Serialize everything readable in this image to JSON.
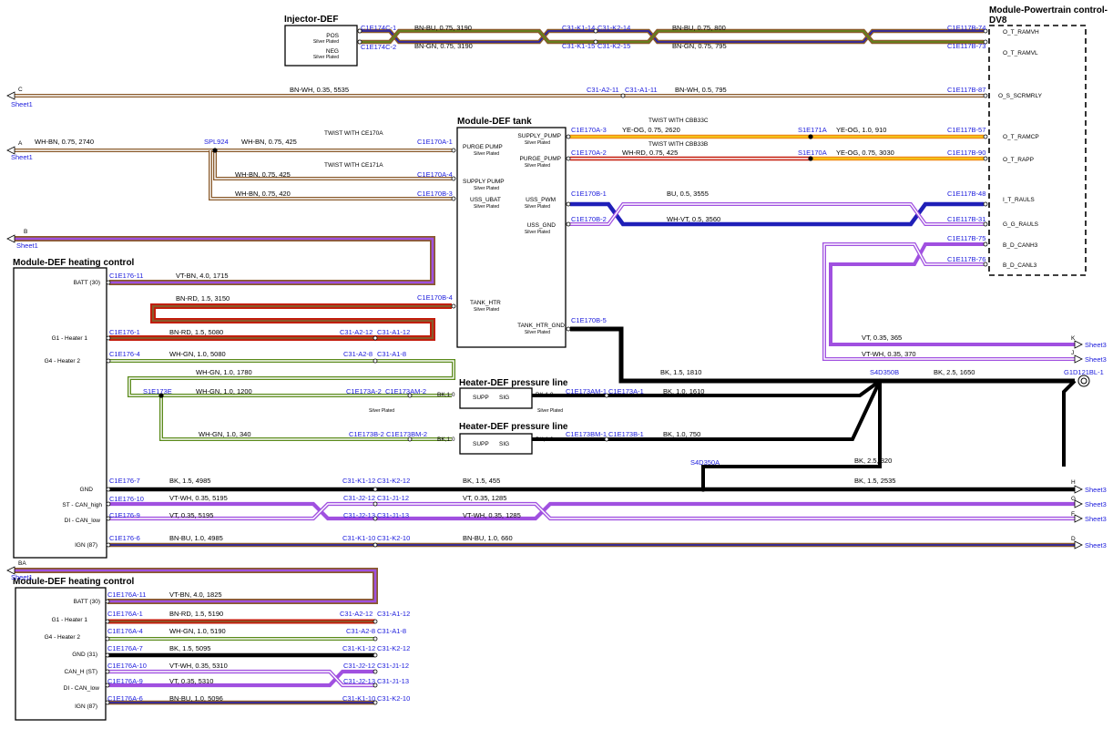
{
  "colors": {
    "BN": "#8a5a2b",
    "BU": "#1f1fb8",
    "GN": "#5a8a1a",
    "WH": "#ffffff",
    "YE": "#f2d318",
    "OG": "#f08a16",
    "RD": "#c41a0a",
    "VT": "#a050e0",
    "BK": "#000000",
    "connector_text": "#1a1adc"
  },
  "modules": {
    "injector": {
      "title": "Injector-DEF",
      "pins": [
        {
          "name": "POS",
          "note": "Silver Plated",
          "connector": "C1E174C-1"
        },
        {
          "name": "NEG",
          "note": "Silver Plated",
          "connector": "C1E174C-2"
        }
      ]
    },
    "pcm": {
      "title_line1": "Module-Powertrain control-",
      "title_line2": "DV8",
      "pins": [
        "O_T_RAMVH",
        "O_T_RAMVL",
        "O_S_SCRMRLY",
        "O_T_RAMCP",
        "O_T_RAPP",
        "I_T_RAULS",
        "G_G_RAULS",
        "B_D_CANH3",
        "B_D_CANL3"
      ]
    },
    "tank": {
      "title": "Module-DEF tank",
      "left_pins": [
        {
          "name": "PURGE PUMP",
          "note": "Silver Plated"
        },
        {
          "name": "SUPPLY PUMP",
          "note": "Silver Plated"
        },
        {
          "name": "USS_UBAT",
          "note": "Silver Plated"
        },
        {
          "name": "TANK_HTR",
          "note": "Silver Plated"
        }
      ],
      "right_pins": [
        {
          "name": "SUPPLY_PUMP",
          "note": "Silver Plated"
        },
        {
          "name": "PURGE_PUMP",
          "note": "Silver Plated"
        },
        {
          "name": "USS_PWM",
          "note": "Silver Plated"
        },
        {
          "name": "USS_GND",
          "note": "Silver Plated"
        },
        {
          "name": "TANK_HTR_GND",
          "note": "Silver Plated"
        }
      ]
    },
    "heating1": {
      "title": "Module-DEF heating control",
      "pins": [
        "BATT (30)",
        "G1 - Heater 1",
        "G4 - Heater 2",
        "GND",
        "ST - CAN_high",
        "DI - CAN_low",
        "IGN (87)"
      ]
    },
    "heating2": {
      "title": "Module-DEF heating control",
      "pins": [
        "BATT (30)",
        "G1 - Heater 1",
        "G4 - Heater 2",
        "GND (31)",
        "CAN_H (ST)",
        "DI - CAN_low",
        "IGN (87)"
      ]
    },
    "pressure_line_1": {
      "title": "Heater-DEF pressure line",
      "supp": "SUPP",
      "sig": "SIG",
      "note": "Silver Plated"
    },
    "pressure_line_2": {
      "title": "Heater-DEF pressure line",
      "supp": "SUPP",
      "sig": "SIG",
      "note": "Silver Plated"
    }
  },
  "connectors": {
    "inj_pos_c31": [
      "C31-K1-14",
      "C31-K2-14"
    ],
    "inj_neg_c31": [
      "C31-K1-15",
      "C31-K2-15"
    ],
    "c_line_c31": [
      "C31-A2-11",
      "C31-A1-11"
    ],
    "pcm_pos": "C1E117B-74",
    "pcm_neg": "C1E117B-73",
    "pcm_c": "C1E117B-87",
    "pcm_ramcp": "C1E117B-57",
    "pcm_rapp": "C1E117B-90",
    "pcm_uls": "C1E117B-48",
    "pcm_gnd": "C1E117B-31",
    "pcm_canh": "C1E117B-75",
    "pcm_canl": "C1E117B-76",
    "tank_a1": "C1E170A-1",
    "tank_a4": "C1E170A-4",
    "tank_b3": "C1E170B-3",
    "tank_a3": "C1E170A-3",
    "tank_a2": "C1E170A-2",
    "tank_b1": "C1E170B-1",
    "tank_b2": "C1E170B-2",
    "tank_b4": "C1E170B-4",
    "tank_b5": "C1E170B-5",
    "splice_spl924": "SPL924",
    "splice_s1e171a": "S1E171A",
    "splice_s1e170a": "S1E170A",
    "splice_s1e173e": "S1E173E",
    "splice_s4d350b": "S4D350B",
    "splice_s4d350a": "S4D350A",
    "ground": "G1D121BL-1",
    "h1": [
      "C1E176-11",
      "C1E176-1",
      "C1E176-4",
      "C1E176-7",
      "C1E176-10",
      "C1E176-9",
      "C1E176-6"
    ],
    "h2": [
      "C1E176A-11",
      "C1E176A-1",
      "C1E176A-4",
      "C1E176A-7",
      "C1E176A-10",
      "C1E176A-9",
      "C1E176A-6"
    ],
    "c31_heater1": [
      "C31-A2-12",
      "C31-A1-12"
    ],
    "c31_heater2": [
      "C31-A2-8",
      "C31-A1-8"
    ],
    "c31_gnd": [
      "C31-K1-12",
      "C31-K2-12"
    ],
    "c31_canh": [
      "C31-J2-12",
      "C31-J1-12"
    ],
    "c31_canl": [
      "C31-J2-13",
      "C31-J1-13"
    ],
    "c31_ign": [
      "C31-K1-10",
      "C31-K2-10"
    ],
    "c173a": [
      "C1E173A-2",
      "C1E173AM-2",
      "C1E173AM-1",
      "C1E173A-1"
    ],
    "c173b": [
      "C1E173B-2",
      "C1E173BM-2",
      "C1E173BM-1",
      "C1E173B-1"
    ]
  },
  "wires": {
    "inj_pos_a": "BN-BU, 0.75, 3190",
    "inj_pos_b": "BN-BU, 0.75, 800",
    "inj_neg_a": "BN-GN, 0.75, 3190",
    "inj_neg_b": "BN-GN, 0.75, 795",
    "c_a": "BN-WH, 0.35, 5535",
    "c_b": "BN-WH, 0.5, 795",
    "a_a": "WH-BN, 0.75, 2740",
    "a_b": "WH-BN, 0.75, 425",
    "a_c": "WH-BN, 0.75, 425",
    "a_d": "WH-BN, 0.75, 420",
    "twist_ce170a": "TWIST WITH CE170A",
    "twist_ce171a": "TWIST WITH CE171A",
    "twist_cbb33c": "TWIST WITH CBB33C",
    "twist_cbb33b": "TWIST WITH CBB33B",
    "supply_a": "YE-OG, 0.75, 2620",
    "supply_b": "YE-OG, 1.0, 910",
    "purge_a": "WH-RD, 0.75, 425",
    "purge_b": "YE-OG, 0.75, 3030",
    "uls": "BU, 0.5, 3555",
    "uls_gnd": "WH-VT, 0.5, 3560",
    "batt": "VT-BN, 4.0, 1715",
    "htr_tank": "BN-RD, 1.5, 3150",
    "htr1": "BN-RD, 1.5, 5080",
    "htr2_a": "WH-GN, 1.0, 5080",
    "htr2_b": "WH-GN, 1.0, 1780",
    "htr2_c": "WH-GN, 1.0, 1200",
    "htr2_d": "WH-GN, 1.0, 340",
    "bk10": "BK,1.0",
    "tank_gnd": "BK, 1.5, 1810",
    "gnd_main": "BK, 2.5, 1650",
    "pl1_gnd": "BK, 1.0, 1610",
    "pl2_gnd": "BK, 1.0, 750",
    "gnd_320": "BK, 2.5, 320",
    "gnd_a": "BK, 1.5, 4985",
    "gnd_b": "BK, 1.5, 455",
    "gnd_c": "BK, 1.5, 2535",
    "canh_a": "VT-WH, 0.35, 5195",
    "canh_b": "VT, 0.35, 1285",
    "canl_a": "VT, 0.35, 5195",
    "canl_b": "VT-WH, 0.35, 1285",
    "k": "VT, 0.35, 365",
    "j": "VT-WH, 0.35, 370",
    "ign_a": "BN-BU, 1.0, 4985",
    "ign_b": "BN-BU, 1.0, 660",
    "h2_batt": "VT-BN, 4.0, 1825",
    "h2_htr1": "BN-RD, 1.5, 5190",
    "h2_htr2": "WH-GN, 1.0, 5190",
    "h2_gnd": "BK, 1.5, 5095",
    "h2_canh": "VT-WH, 0.35, 5310",
    "h2_canl": "VT, 0.35, 5310",
    "h2_ign": "BN-BU, 1.0, 5096"
  },
  "sheet_refs": {
    "c": {
      "letter": "C",
      "sheet": "Sheet1"
    },
    "a": {
      "letter": "A",
      "sheet": "Sheet1"
    },
    "b": {
      "letter": "B",
      "sheet": "Sheet1"
    },
    "ba": {
      "letter": "BA",
      "sheet": "Sheet1"
    },
    "k": {
      "letter": "K",
      "sheet": "Sheet3"
    },
    "j": {
      "letter": "J",
      "sheet": "Sheet3"
    },
    "h": {
      "letter": "H",
      "sheet": "Sheet3"
    },
    "g": {
      "letter": "G",
      "sheet": "Sheet3"
    },
    "f": {
      "letter": "F",
      "sheet": "Sheet3"
    },
    "d": {
      "letter": "D",
      "sheet": "Sheet3"
    }
  }
}
